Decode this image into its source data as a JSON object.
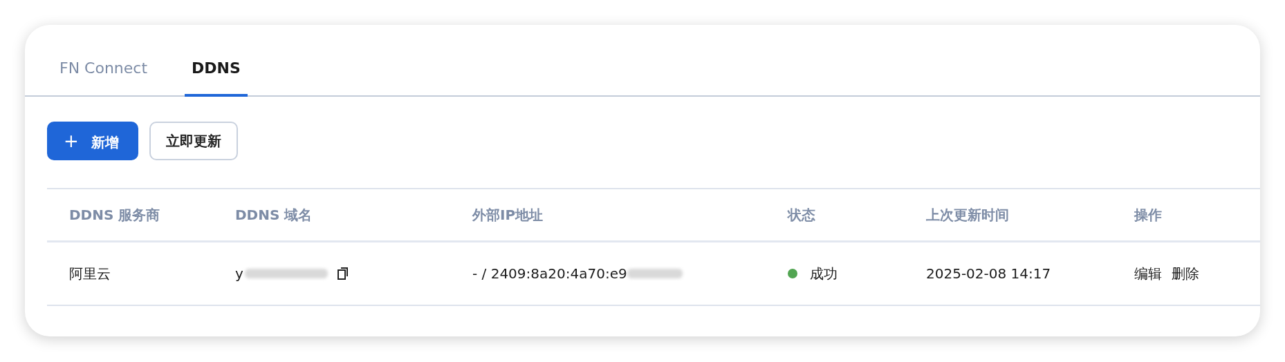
{
  "tabs": [
    {
      "label": "FN Connect",
      "selected": false
    },
    {
      "label": "DDNS",
      "selected": true
    }
  ],
  "toolbar": {
    "add_button": {
      "icon": "+",
      "label": "新增"
    },
    "update_button": "立即更新"
  },
  "table": {
    "columns": [
      "DDNS 服务商",
      "DDNS 域名",
      "外部IP地址",
      "状态",
      "上次更新时间",
      "操作"
    ],
    "rows": [
      {
        "provider": "阿里云",
        "domain": "y",
        "ip": "- / 2409:8a20:4a70:e9",
        "status": {
          "label": "成功",
          "color": "#52a552"
        },
        "updated": "2025-02-08 14:17",
        "actions": [
          "编辑",
          "删除"
        ]
      }
    ]
  }
}
